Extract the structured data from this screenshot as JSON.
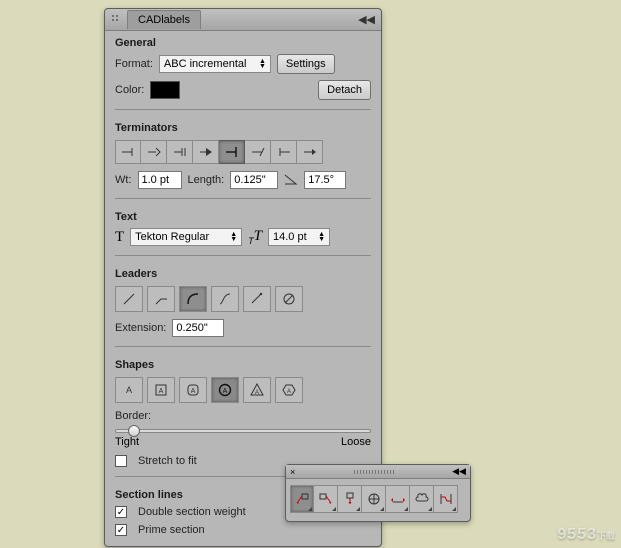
{
  "panel": {
    "title": "CADlabels",
    "collapse_glyph": "◀◀",
    "sections": {
      "general": {
        "heading": "General",
        "format_label": "Format:",
        "format_value": "ABC incremental",
        "settings_btn": "Settings",
        "color_label": "Color:",
        "color_value": "#000000",
        "detach_btn": "Detach"
      },
      "terminators": {
        "heading": "Terminators",
        "wt_label": "Wt:",
        "wt_value": "1.0 pt",
        "length_label": "Length:",
        "length_value": "0.125\"",
        "angle_value": "17.5°"
      },
      "text": {
        "heading": "Text",
        "font_value": "Tekton Regular",
        "size_value": "14.0 pt"
      },
      "leaders": {
        "heading": "Leaders",
        "extension_label": "Extension:",
        "extension_value": "0.250\""
      },
      "shapes": {
        "heading": "Shapes",
        "border_label": "Border:",
        "tight_label": "Tight",
        "loose_label": "Loose",
        "stretch_label": "Stretch to fit"
      },
      "section_lines": {
        "heading": "Section lines",
        "double_label": "Double section weight",
        "prime_label": "Prime section",
        "double_checked": true,
        "prime_checked": true
      }
    }
  },
  "toolbar": {
    "close_glyph": "×",
    "collapse_glyph": "◀◀"
  },
  "watermark": {
    "main": "9553",
    "sub": "下载"
  }
}
